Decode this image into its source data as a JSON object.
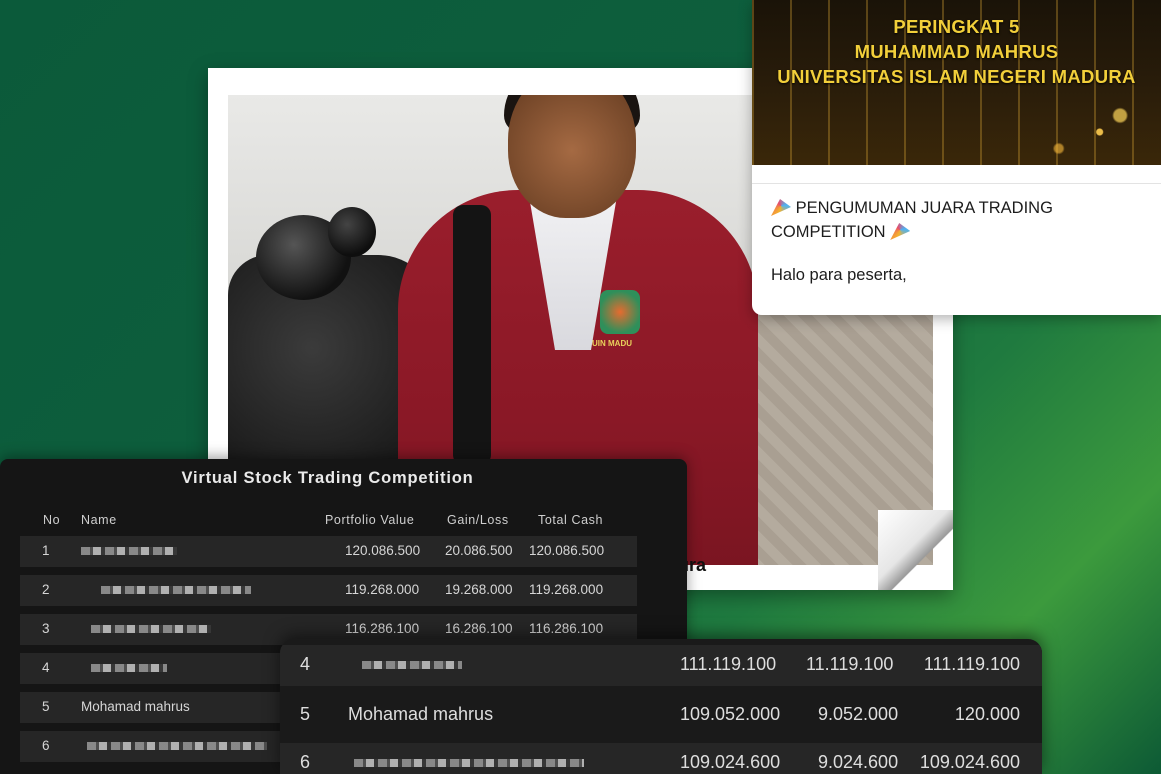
{
  "announcement": {
    "banner_lines": [
      "PERINGKAT 5",
      "MUHAMMAD MAHRUS",
      "UNIVERSITAS ISLAM NEGERI MADURA"
    ],
    "title_line1": "PENGUMUMAN JUARA TRADING",
    "title_line2": "COMPETITION",
    "greeting": "Halo para peserta,",
    "icon": "party-popper-icon",
    "banner_text_color": "#f2cf3a"
  },
  "photo": {
    "caption": "ura",
    "emblem_text": "UIN MADU"
  },
  "leaderboard": {
    "title": "Virtual Stock Trading Competition",
    "headers": {
      "no": "No",
      "name": "Name",
      "portfolio_value": "Portfolio Value",
      "gain_loss": "Gain/Loss",
      "total_cash": "Total Cash"
    },
    "rows": [
      {
        "no": "1",
        "name": "",
        "portfolio_value": "120.086.500",
        "gain_loss": "20.086.500",
        "total_cash": "120.086.500"
      },
      {
        "no": "2",
        "name": "",
        "portfolio_value": "119.268.000",
        "gain_loss": "19.268.000",
        "total_cash": "119.268.000"
      },
      {
        "no": "3",
        "name": "",
        "portfolio_value": "116.286.100",
        "gain_loss": "16.286.100",
        "total_cash": "116.286.100"
      },
      {
        "no": "4",
        "name": ""
      },
      {
        "no": "5",
        "name": "Mohamad mahrus"
      },
      {
        "no": "6",
        "name": ""
      }
    ]
  },
  "zoomed": {
    "rows": [
      {
        "no": "4",
        "name": "",
        "portfolio_value": "111.119.100",
        "gain_loss": "11.119.100",
        "total_cash": "111.119.100"
      },
      {
        "no": "5",
        "name": "Mohamad mahrus",
        "portfolio_value": "109.052.000",
        "gain_loss": "9.052.000",
        "total_cash": "120.000"
      },
      {
        "no": "6",
        "name": "",
        "portfolio_value": "109.024.600",
        "gain_loss": "9.024.600",
        "total_cash": "109.024.600"
      }
    ]
  },
  "colors": {
    "background_green": "#0b5a3a",
    "jacket_red": "#9a1e2c",
    "board_dark": "#151515"
  }
}
